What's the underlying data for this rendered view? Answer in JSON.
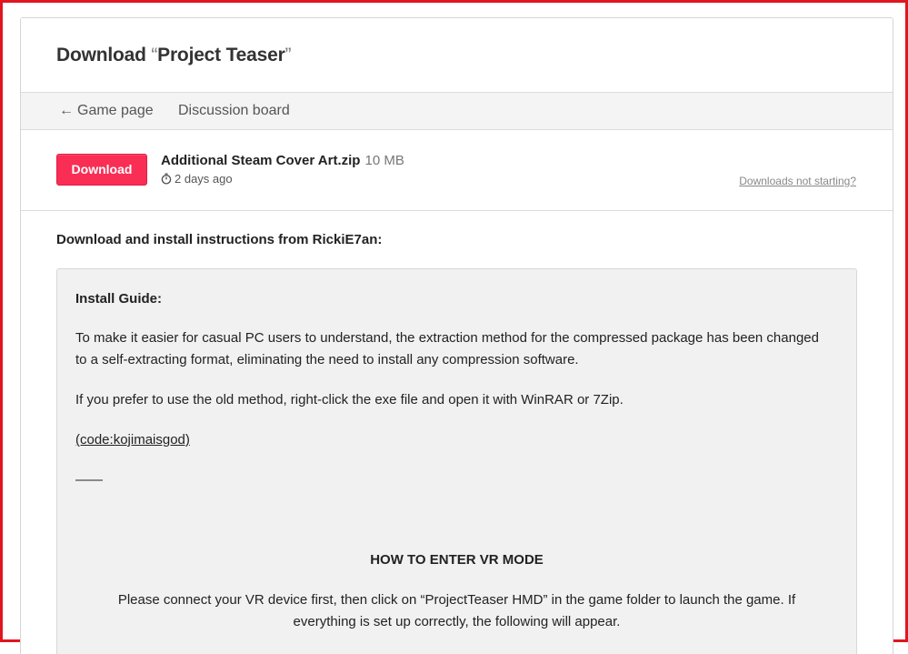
{
  "header": {
    "title_prefix": "Download ",
    "open_quote": "“",
    "game_name": "Project Teaser",
    "close_quote": "”"
  },
  "nav": {
    "game_page_arrow": "←",
    "game_page": "Game page",
    "discussion_board": "Discussion board"
  },
  "upload": {
    "download_button": "Download",
    "file_name": "Additional Steam Cover Art.zip",
    "file_size": "10 MB",
    "date": "2 days ago",
    "not_starting": "Downloads not starting?"
  },
  "instructions": {
    "heading": "Download and install instructions from RickiE7an:",
    "guide_title": "Install Guide:",
    "paragraph_1": "To make it easier for casual PC users to understand, the extraction method for the compressed package has been changed to a self-extracting format, eliminating the need to install any compression software.",
    "paragraph_2": "If you prefer to use the old method, right-click the exe file and open it with WinRAR or 7Zip.",
    "code": "(code:kojimaisgod)",
    "dash": "——",
    "vr_title": "HOW TO ENTER VR MODE",
    "vr_text": "Please connect your VR device first, then click on “ProjectTeaser HMD” in the game folder to launch the game. If everything is set up correctly, the following will appear."
  },
  "colors": {
    "frame_border": "#e0161e",
    "download_button": "#fa2d55",
    "nav_background": "#f4f4f4",
    "instructions_background": "#f1f1f1"
  }
}
